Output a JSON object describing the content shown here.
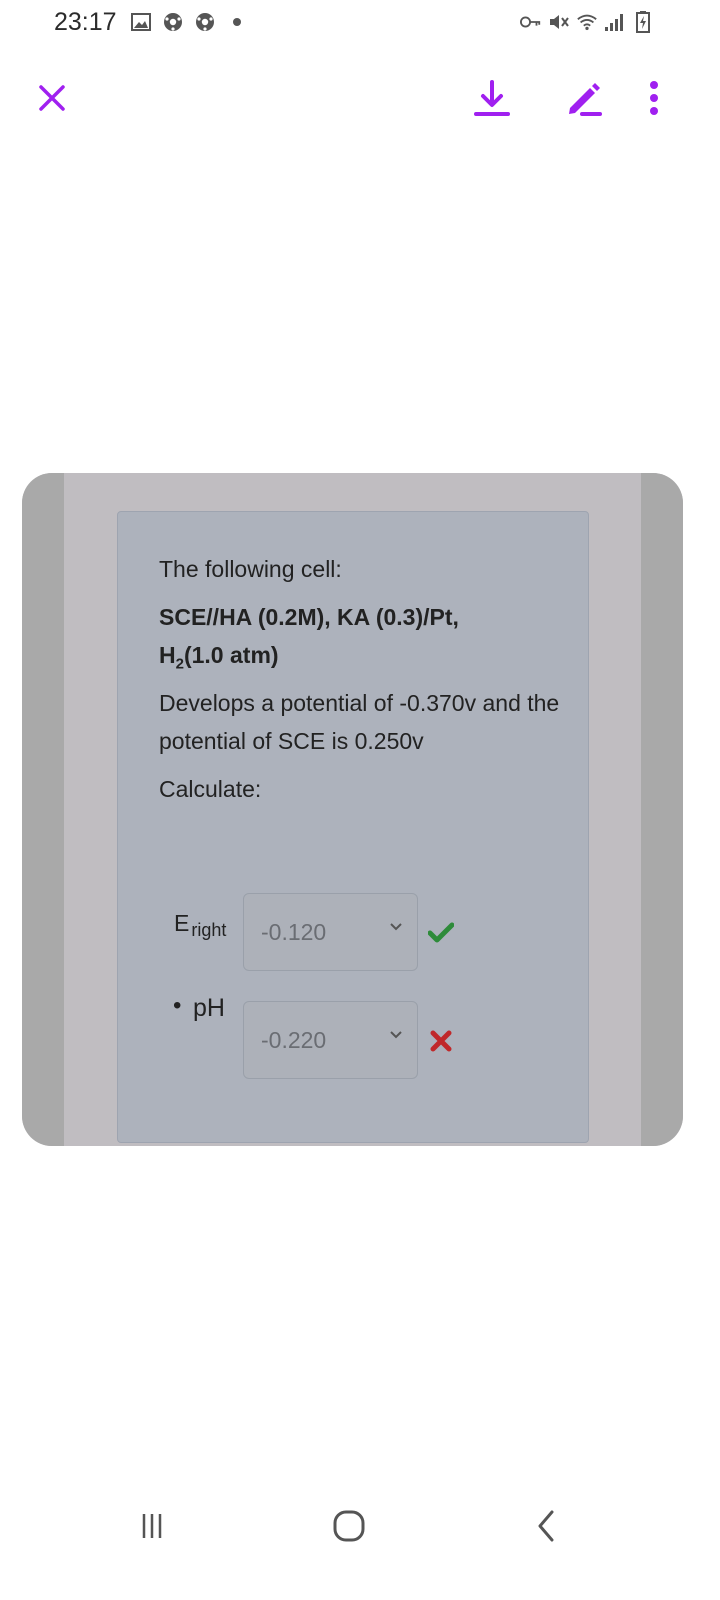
{
  "status_bar": {
    "time": "23:17",
    "left_icons": [
      "gallery-icon",
      "soccer-ball-icon",
      "soccer-ball-icon",
      "dot-icon"
    ],
    "right_icons": [
      "key-icon",
      "mute-icon",
      "wifi-icon",
      "signal-icon",
      "battery-charging-icon"
    ]
  },
  "toolbar": {
    "accent_color": "#a020f0",
    "buttons": [
      "close-icon",
      "download-icon",
      "edit-icon",
      "more-icon"
    ]
  },
  "question": {
    "intro": "The following cell:",
    "formula_line1": "SCE//HA (0.2M), KA (0.3)/Pt,",
    "formula_line2_prefix": "H",
    "formula_line2_sub": "2",
    "formula_line2_suffix": "(1.0 atm)",
    "develops": "Develops a potential of -0.370v and the potential of SCE is 0.250v",
    "calculate": "Calculate:"
  },
  "answers": [
    {
      "label_main": "E",
      "label_sub": "right",
      "value": "-0.120",
      "status": "correct",
      "status_color": "#2e8b3a"
    },
    {
      "label_bullet": "•",
      "label_main": "pH",
      "value": "-0.220",
      "status": "incorrect",
      "status_color": "#c0282a"
    }
  ],
  "nav_bar": {
    "buttons": [
      "recent-apps-icon",
      "home-icon",
      "back-icon"
    ]
  }
}
